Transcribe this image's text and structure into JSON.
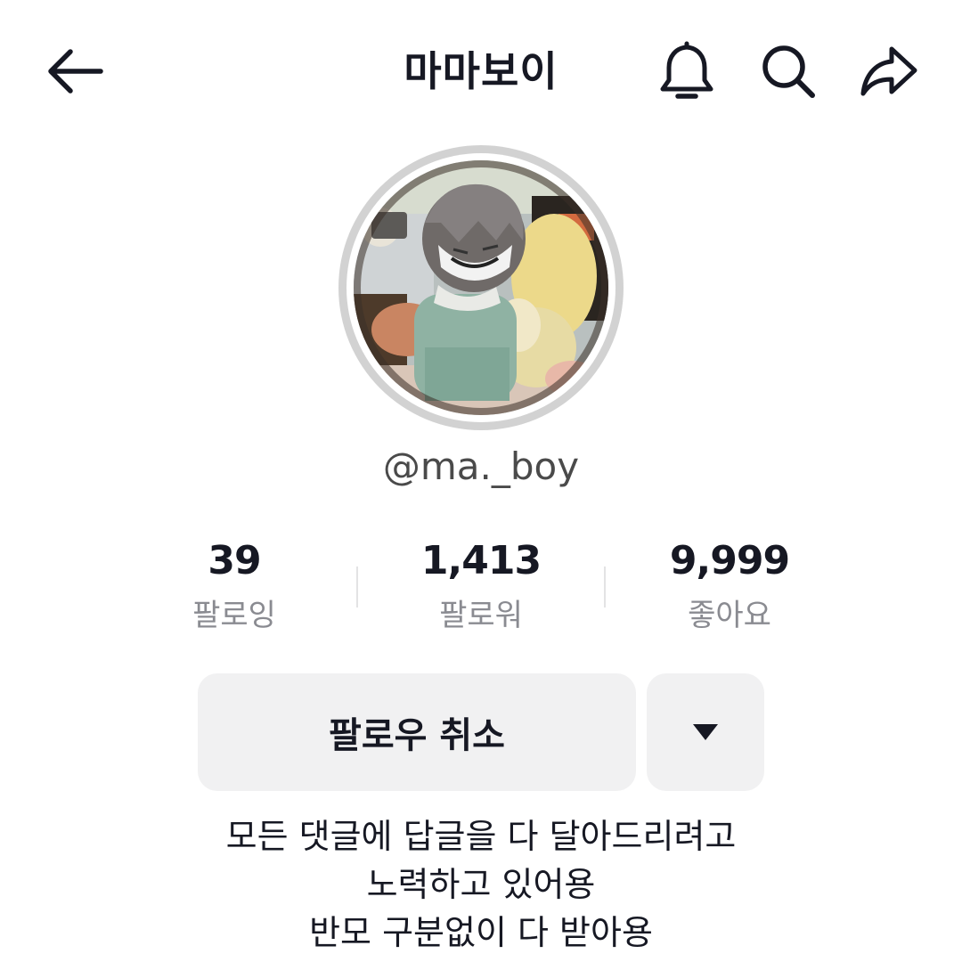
{
  "header": {
    "title": "마마보이",
    "icons": {
      "back": "back-arrow-icon",
      "notification": "bell-icon",
      "search": "search-icon",
      "share": "share-icon"
    }
  },
  "profile": {
    "username": "@ma._boy",
    "avatar": "profile-photo"
  },
  "stats": [
    {
      "value": "39",
      "label": "팔로잉"
    },
    {
      "value": "1,413",
      "label": "팔로워"
    },
    {
      "value": "9,999",
      "label": "좋아요"
    }
  ],
  "actions": {
    "unfollow_label": "팔로우 취소",
    "more_icon": "caret-down-icon"
  },
  "bio": {
    "lines": [
      "모든 댓글에 답글을 다 달아드리려고",
      "노력하고 있어용",
      "반모 구분없이 다 받아용"
    ]
  },
  "colors": {
    "text_primary": "#161823",
    "text_secondary": "#8a8b91",
    "button_bg": "#f1f1f2",
    "avatar_ring": "#d2d2d2"
  }
}
